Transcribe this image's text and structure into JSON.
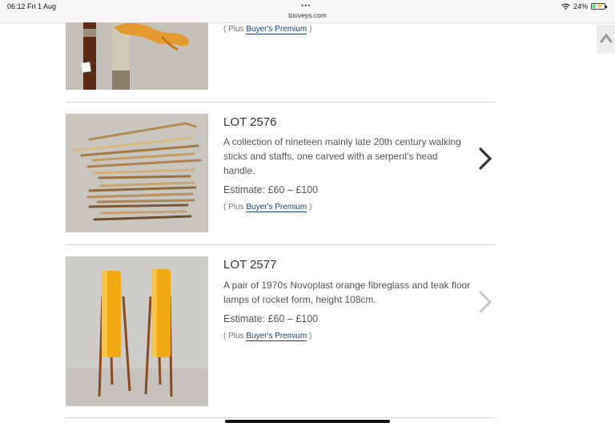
{
  "status_bar": {
    "time_date": "06:12  Fri 1 Aug",
    "dots": "•••",
    "url": "tooveys.com",
    "battery": "24%",
    "battery_level": 0.24
  },
  "lots": [
    {
      "premium_prefix": "( Plus ",
      "premium_link": "Buyer's Premium",
      "premium_suffix": " )"
    },
    {
      "title": "LOT 2576",
      "description": "A collection of nineteen mainly late 20th century walking sticks and staffs, one carved with a serpent's head handle.",
      "estimate": "Estimate: £60 – £100",
      "premium_prefix": "( Plus ",
      "premium_link": "Buyer's Premium",
      "premium_suffix": " )"
    },
    {
      "title": "LOT 2577",
      "description": "A pair of 1970s Novoplast orange fibreglass and teak floor lamps of rocket form, height 108cm.",
      "estimate": "Estimate: £60 – £100",
      "premium_prefix": "( Plus ",
      "premium_link": "Buyer's Premium",
      "premium_suffix": " )"
    }
  ],
  "icons": {
    "back_to_top": "chevron-up-icon",
    "next": "chevron-right-icon",
    "wifi": "wifi-icon",
    "battery": "battery-icon"
  },
  "colors": {
    "link": "#1a3e78",
    "text": "#555555",
    "divider": "#d6d6d6"
  }
}
